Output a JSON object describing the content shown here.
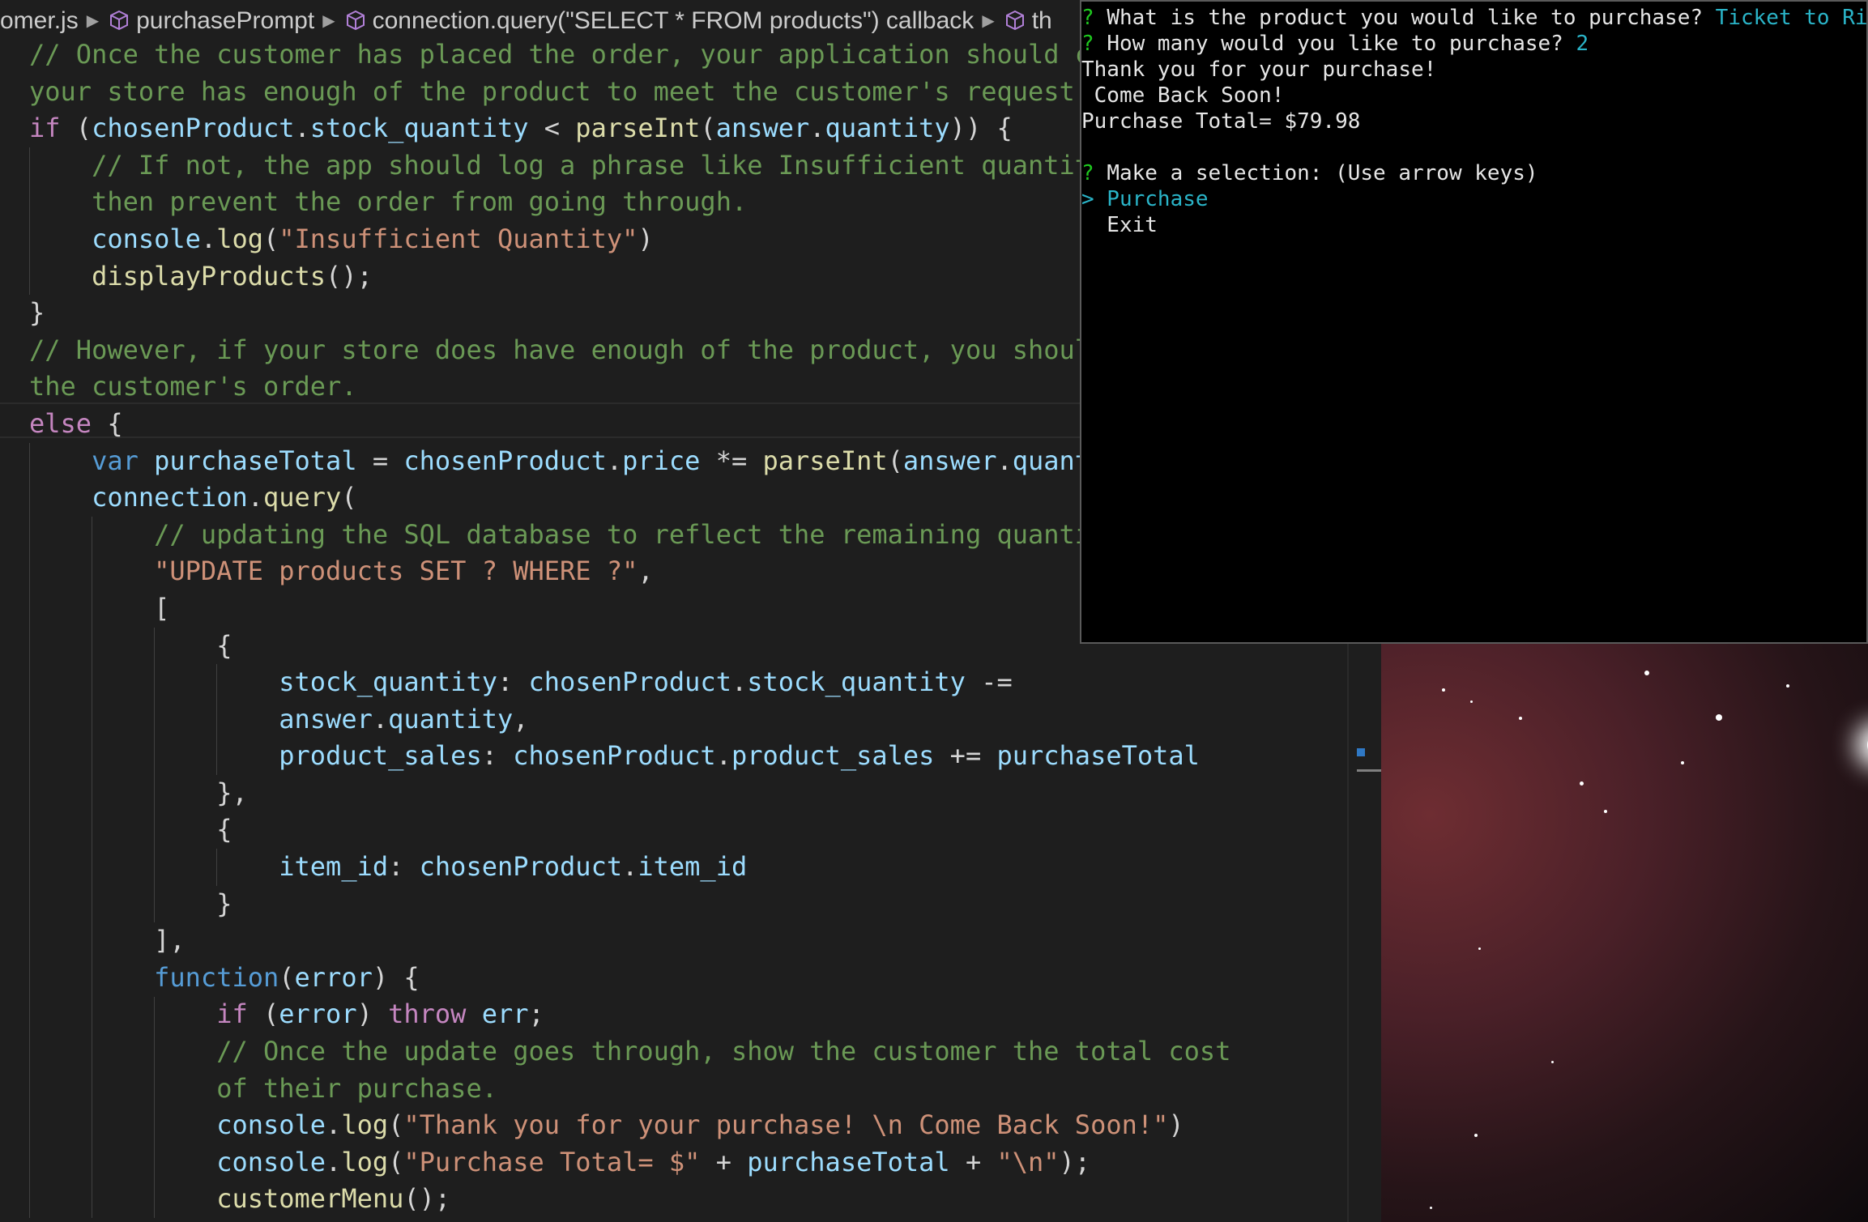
{
  "breadcrumb": {
    "items": [
      "omer.js",
      "purchasePrompt",
      "connection.query(\"SELECT * FROM products\") callback",
      "th"
    ]
  },
  "code": {
    "lines": [
      {
        "indent": 0,
        "tokens": [
          [
            "com",
            "// Once the customer has placed the order, your application should che"
          ]
        ]
      },
      {
        "indent": 0,
        "tokens": [
          [
            "com",
            "your store has enough of the product to meet the customer's request."
          ]
        ]
      },
      {
        "indent": 0,
        "tokens": [
          [
            "kw",
            "if"
          ],
          [
            "p",
            " ("
          ],
          [
            "var",
            "chosenProduct"
          ],
          [
            "p",
            "."
          ],
          [
            "var",
            "stock_quantity"
          ],
          [
            "p",
            " < "
          ],
          [
            "fn",
            "parseInt"
          ],
          [
            "p",
            "("
          ],
          [
            "var",
            "answer"
          ],
          [
            "p",
            "."
          ],
          [
            "var",
            "quantity"
          ],
          [
            "p",
            ")) {"
          ]
        ]
      },
      {
        "indent": 1,
        "tokens": [
          [
            "com",
            "// If not, the app should log a phrase like Insufficient quantity!"
          ]
        ]
      },
      {
        "indent": 1,
        "tokens": [
          [
            "com",
            "then prevent the order from going through."
          ]
        ]
      },
      {
        "indent": 1,
        "tokens": [
          [
            "var",
            "console"
          ],
          [
            "p",
            "."
          ],
          [
            "fn",
            "log"
          ],
          [
            "p",
            "("
          ],
          [
            "str",
            "\"Insufficient Quantity\""
          ],
          [
            "p",
            ")"
          ]
        ]
      },
      {
        "indent": 1,
        "tokens": [
          [
            "fn",
            "displayProducts"
          ],
          [
            "p",
            "();"
          ]
        ]
      },
      {
        "indent": 0,
        "tokens": [
          [
            "p",
            "}"
          ]
        ]
      },
      {
        "indent": 0,
        "tokens": [
          [
            "com",
            "// However, if your store does have enough of the product, you should "
          ]
        ]
      },
      {
        "indent": 0,
        "tokens": [
          [
            "com",
            "the customer's order."
          ]
        ]
      },
      {
        "indent": 0,
        "tokens": [
          [
            "kw",
            "else"
          ],
          [
            "p",
            " {"
          ]
        ]
      },
      {
        "indent": 1,
        "tokens": [
          [
            "key",
            "var"
          ],
          [
            "p",
            " "
          ],
          [
            "var",
            "purchaseTotal"
          ],
          [
            "p",
            " = "
          ],
          [
            "var",
            "chosenProduct"
          ],
          [
            "p",
            "."
          ],
          [
            "var",
            "price"
          ],
          [
            "p",
            " *= "
          ],
          [
            "fn",
            "parseInt"
          ],
          [
            "p",
            "("
          ],
          [
            "var",
            "answer"
          ],
          [
            "p",
            "."
          ],
          [
            "var",
            "quantity"
          ]
        ]
      },
      {
        "indent": 1,
        "tokens": [
          [
            "var",
            "connection"
          ],
          [
            "p",
            "."
          ],
          [
            "fn",
            "query"
          ],
          [
            "p",
            "("
          ]
        ]
      },
      {
        "indent": 2,
        "tokens": [
          [
            "com",
            "// updating the SQL database to reflect the remaining quantity"
          ]
        ]
      },
      {
        "indent": 2,
        "tokens": [
          [
            "str",
            "\"UPDATE products SET ? WHERE ?\""
          ],
          [
            "p",
            ","
          ]
        ]
      },
      {
        "indent": 2,
        "tokens": [
          [
            "p",
            "["
          ]
        ]
      },
      {
        "indent": 3,
        "tokens": [
          [
            "p",
            "{"
          ]
        ]
      },
      {
        "indent": 4,
        "tokens": [
          [
            "var",
            "stock_quantity"
          ],
          [
            "p",
            ": "
          ],
          [
            "var",
            "chosenProduct"
          ],
          [
            "p",
            "."
          ],
          [
            "var",
            "stock_quantity"
          ],
          [
            "p",
            " -="
          ]
        ]
      },
      {
        "indent": 4,
        "tokens": [
          [
            "var",
            "answer"
          ],
          [
            "p",
            "."
          ],
          [
            "var",
            "quantity"
          ],
          [
            "p",
            ","
          ]
        ]
      },
      {
        "indent": 4,
        "tokens": [
          [
            "var",
            "product_sales"
          ],
          [
            "p",
            ": "
          ],
          [
            "var",
            "chosenProduct"
          ],
          [
            "p",
            "."
          ],
          [
            "var",
            "product_sales"
          ],
          [
            "p",
            " += "
          ],
          [
            "var",
            "purchaseTotal"
          ]
        ]
      },
      {
        "indent": 3,
        "tokens": [
          [
            "p",
            "},"
          ]
        ]
      },
      {
        "indent": 3,
        "tokens": [
          [
            "p",
            "{"
          ]
        ]
      },
      {
        "indent": 4,
        "tokens": [
          [
            "var",
            "item_id"
          ],
          [
            "p",
            ": "
          ],
          [
            "var",
            "chosenProduct"
          ],
          [
            "p",
            "."
          ],
          [
            "var",
            "item_id"
          ]
        ]
      },
      {
        "indent": 3,
        "tokens": [
          [
            "p",
            "}"
          ]
        ]
      },
      {
        "indent": 2,
        "tokens": [
          [
            "p",
            "],"
          ]
        ]
      },
      {
        "indent": 2,
        "tokens": [
          [
            "key",
            "function"
          ],
          [
            "p",
            "("
          ],
          [
            "var",
            "error"
          ],
          [
            "p",
            ") {"
          ]
        ]
      },
      {
        "indent": 3,
        "tokens": [
          [
            "kw",
            "if"
          ],
          [
            "p",
            " ("
          ],
          [
            "var",
            "error"
          ],
          [
            "p",
            ") "
          ],
          [
            "kw",
            "throw"
          ],
          [
            "p",
            " "
          ],
          [
            "var",
            "err"
          ],
          [
            "p",
            ";"
          ]
        ]
      },
      {
        "indent": 3,
        "tokens": [
          [
            "com",
            "// Once the update goes through, show the customer the total cost"
          ]
        ]
      },
      {
        "indent": 3,
        "tokens": [
          [
            "com",
            "of their purchase."
          ]
        ]
      },
      {
        "indent": 3,
        "tokens": [
          [
            "var",
            "console"
          ],
          [
            "p",
            "."
          ],
          [
            "fn",
            "log"
          ],
          [
            "p",
            "("
          ],
          [
            "str",
            "\"Thank you for your purchase! \\n Come Back Soon!\""
          ],
          [
            "p",
            ")"
          ]
        ]
      },
      {
        "indent": 3,
        "tokens": [
          [
            "var",
            "console"
          ],
          [
            "p",
            "."
          ],
          [
            "fn",
            "log"
          ],
          [
            "p",
            "("
          ],
          [
            "str",
            "\"Purchase Total= $\""
          ],
          [
            "p",
            " + "
          ],
          [
            "var",
            "purchaseTotal"
          ],
          [
            "p",
            " + "
          ],
          [
            "str",
            "\"\\n\""
          ],
          [
            "p",
            ");"
          ]
        ]
      },
      {
        "indent": 3,
        "tokens": [
          [
            "fn",
            "customerMenu"
          ],
          [
            "p",
            "();"
          ]
        ]
      }
    ]
  },
  "terminal": {
    "lines": [
      {
        "parts": [
          [
            "q",
            "? "
          ],
          [
            "t",
            "What is the product you would like to purchase? "
          ],
          [
            "ans",
            "Ticket to Ride"
          ]
        ]
      },
      {
        "parts": [
          [
            "q",
            "? "
          ],
          [
            "t",
            "How many would you like to purchase? "
          ],
          [
            "ans",
            "2"
          ]
        ]
      },
      {
        "parts": [
          [
            "t",
            "Thank you for your purchase!"
          ]
        ]
      },
      {
        "parts": [
          [
            "t",
            " Come Back Soon!"
          ]
        ]
      },
      {
        "parts": [
          [
            "t",
            "Purchase Total= $79.98"
          ]
        ]
      },
      {
        "parts": [
          [
            "t",
            ""
          ]
        ]
      },
      {
        "parts": [
          [
            "q",
            "? "
          ],
          [
            "t",
            "Make a selection: (Use arrow keys)"
          ]
        ]
      },
      {
        "parts": [
          [
            "sel",
            "> Purchase"
          ]
        ]
      },
      {
        "parts": [
          [
            "t",
            "  Exit"
          ]
        ]
      }
    ]
  },
  "colors": {
    "editor_bg": "#1e1e1e",
    "comment": "#6a9955",
    "keyword": "#c586c0",
    "storage": "#569cd6",
    "variable": "#9cdcfe",
    "function": "#dcdcaa",
    "string": "#ce9178",
    "terminal_bg": "#000000",
    "terminal_prompt": "#1ec81e",
    "terminal_answer": "#2ab4c8"
  }
}
